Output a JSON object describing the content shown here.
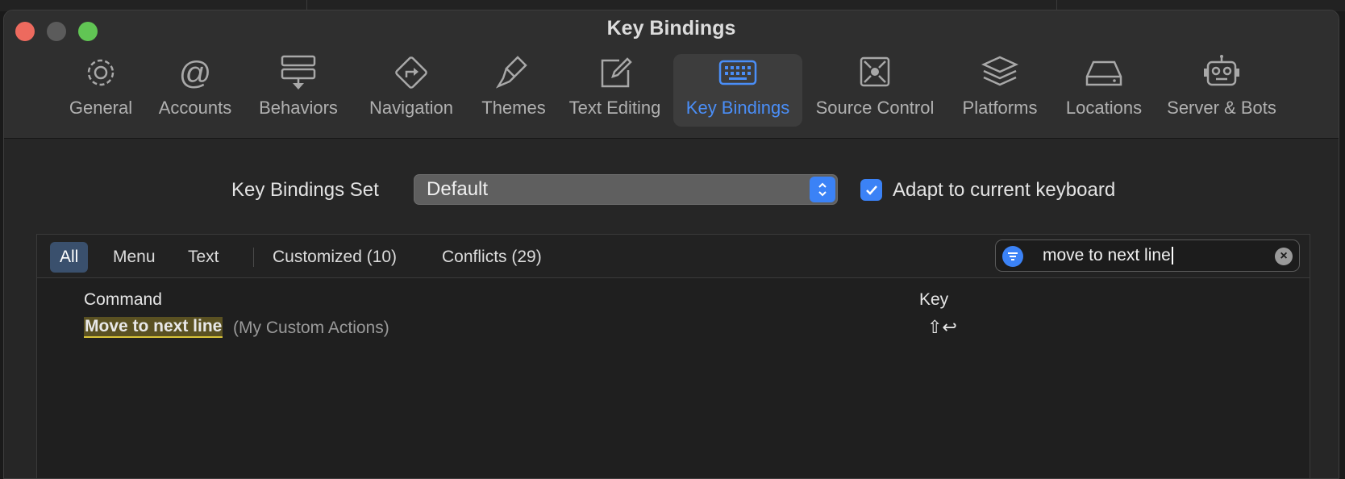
{
  "window": {
    "title": "Key Bindings"
  },
  "toolbar": {
    "tabs": [
      {
        "label": "General",
        "icon": "gear-icon"
      },
      {
        "label": "Accounts",
        "icon": "at-icon"
      },
      {
        "label": "Behaviors",
        "icon": "behaviors-icon"
      },
      {
        "label": "Navigation",
        "icon": "navigation-icon"
      },
      {
        "label": "Themes",
        "icon": "paintbrush-icon"
      },
      {
        "label": "Text Editing",
        "icon": "pencil-square-icon"
      },
      {
        "label": "Key Bindings",
        "icon": "keyboard-icon",
        "active": true
      },
      {
        "label": "Source Control",
        "icon": "source-control-icon"
      },
      {
        "label": "Platforms",
        "icon": "layers-icon"
      },
      {
        "label": "Locations",
        "icon": "drive-icon"
      },
      {
        "label": "Server & Bots",
        "icon": "robot-icon"
      }
    ]
  },
  "keyset": {
    "label": "Key Bindings Set",
    "value": "Default",
    "adapt_label": "Adapt to current keyboard",
    "adapt_checked": true
  },
  "filters": {
    "all": "All",
    "menu": "Menu",
    "text": "Text",
    "customized": "Customized (10)",
    "conflicts": "Conflicts (29)"
  },
  "search": {
    "value": "move to next line"
  },
  "table": {
    "headers": {
      "command": "Command",
      "key": "Key"
    },
    "rows": [
      {
        "command": "Move to next line",
        "group": "(My Custom Actions)",
        "key": "⇧↩"
      }
    ]
  },
  "colors": {
    "accent": "#3b82f6",
    "active_tab": "#4a8ef7",
    "highlight": "#5a5122",
    "highlight_underline": "#d8c33a"
  }
}
